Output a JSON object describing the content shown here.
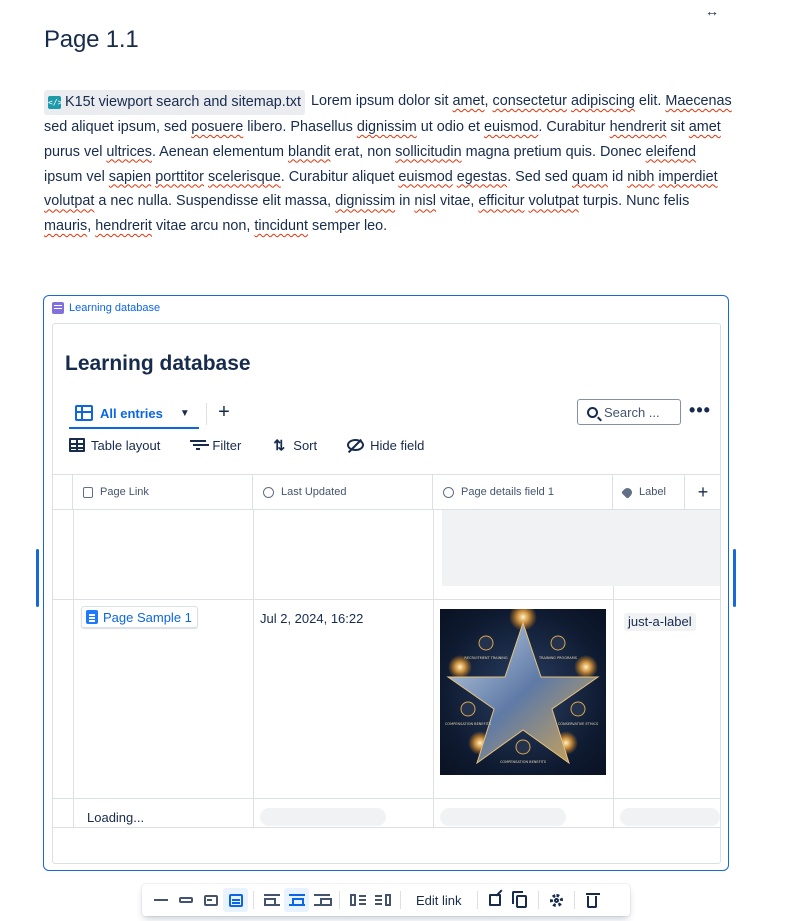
{
  "page": {
    "title": "Page 1.1",
    "expand_icon": "arrows-horizontal-icon"
  },
  "paragraph": {
    "file_name": "K15t viewport search and sitemap.txt",
    "file_icon": "code-file-icon",
    "segments": [
      " Lorem ipsum dolor sit ",
      "amet",
      ", ",
      "consectetur",
      " ",
      "adipiscing",
      " elit. ",
      "Maecenas",
      " sed aliquet ipsum, sed ",
      "posuere",
      " libero. Phasellus ",
      "dignissim",
      " ut odio et ",
      "euismod",
      ". Curabitur ",
      "hendrerit",
      " sit ",
      "amet",
      " purus vel ",
      "ultrices",
      ". Aenean elementum ",
      "blandit",
      " erat, non ",
      "sollicitudin",
      " magna pretium quis. ",
      "Donec ",
      "eleifend",
      " ipsum vel ",
      "sapien",
      " ",
      "porttitor",
      " ",
      "scelerisque",
      ". Curabitur aliquet ",
      "euismod",
      " ",
      "egestas",
      ". Sed sed ",
      "quam",
      " id ",
      "nibh",
      " ",
      "imperdiet",
      " ",
      "volutpat",
      " a nec nulla. Suspendisse elit massa, ",
      "dignissim",
      " in ",
      "nisl",
      " vitae, ",
      "efficitur",
      " ",
      "volutpat",
      " turpis. Nunc felis ",
      "mauris",
      ", ",
      "hendrerit",
      " vitae arcu non, ",
      "tincidunt",
      " semper leo."
    ]
  },
  "macro": {
    "label": "Learning database",
    "icon": "database-icon"
  },
  "database": {
    "title": "Learning database",
    "view_tab": "All entries",
    "search_placeholder": "Search ...",
    "more_label": "•••",
    "add_view": "+",
    "toolbar": {
      "table_layout": "Table layout",
      "filter": "Filter",
      "sort": "Sort",
      "hide_field": "Hide field"
    },
    "columns": [
      {
        "label": "Page Link",
        "icon": "page-icon"
      },
      {
        "label": "Last Updated",
        "icon": "info-icon"
      },
      {
        "label": "Page details field 1",
        "icon": "info-icon"
      },
      {
        "label": "Label",
        "icon": "tag-icon"
      }
    ],
    "add_column": "+",
    "rows": [
      {
        "page_link": "Page Sample 1",
        "last_updated": "Jul 2, 2024, 16:22",
        "image_alt": "star-graphic",
        "image_labels": [
          "RECRUITMENT TRAINING",
          "TRAINING PROGRAMS",
          "COMPENSATION BENEFITS",
          "CONSERVATIVE ETHICS",
          "COMPENSATION BENEFITS"
        ],
        "label": "just-a-label"
      }
    ],
    "loading_text": "Loading..."
  },
  "float_toolbar": {
    "edit_link": "Edit link",
    "buttons": [
      "inline-view-icon",
      "smart-link-icon",
      "card-view-icon",
      "embed-view-icon",
      "align-left-icon",
      "align-center-icon",
      "align-right-icon",
      "wrap-left-icon",
      "wrap-right-icon",
      "open-external-icon",
      "copy-icon",
      "settings-icon",
      "delete-icon"
    ]
  },
  "colors": {
    "accent": "#0c66e4",
    "text": "#172b4d",
    "border": "#dcdfe4",
    "macro_border": "#1868db",
    "spell_underline": "#de350b"
  }
}
